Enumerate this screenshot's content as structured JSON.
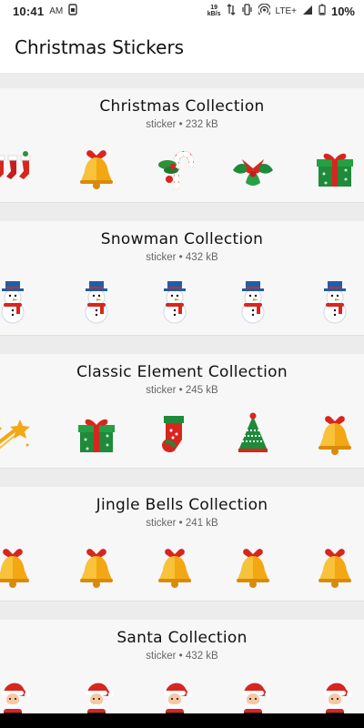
{
  "status_bar": {
    "time": "10:41",
    "carrier_badge": "AM",
    "speed_value": "19",
    "speed_unit": "kB/s",
    "network": "LTE+",
    "battery": "10%"
  },
  "app_bar": {
    "title": "Christmas Stickers"
  },
  "collections": [
    {
      "title": "Christmas Collection",
      "meta": "sticker • 232 kB",
      "stickers": [
        "stockings-icon",
        "bell-icon",
        "candy-cane-icon",
        "holly-icon",
        "gift-box-icon"
      ]
    },
    {
      "title": "Snowman Collection",
      "meta": "sticker • 432 kB",
      "stickers": [
        "snowman-icon",
        "snowman-icon",
        "snowman-icon",
        "snowman-icon",
        "snowman-icon"
      ]
    },
    {
      "title": "Classic Element Collection",
      "meta": "sticker • 245 kB",
      "stickers": [
        "shooting-star-icon",
        "gift-box-icon",
        "stocking-icon",
        "christmas-tree-icon",
        "bell-icon"
      ]
    },
    {
      "title": "Jingle Bells Collection",
      "meta": "sticker • 241 kB",
      "stickers": [
        "bell-icon",
        "bell-icon",
        "bell-icon",
        "bell-icon",
        "bell-icon"
      ]
    },
    {
      "title": "Santa Collection",
      "meta": "sticker • 432 kB",
      "stickers": [
        "santa-icon",
        "santa-icon",
        "santa-icon",
        "santa-icon",
        "santa-icon"
      ]
    }
  ],
  "colors": {
    "red": "#d7261e",
    "green": "#1f8a3a",
    "gold": "#f3a712",
    "appbar_bg": "#ffffff",
    "card_bg": "#f7f7f7"
  }
}
